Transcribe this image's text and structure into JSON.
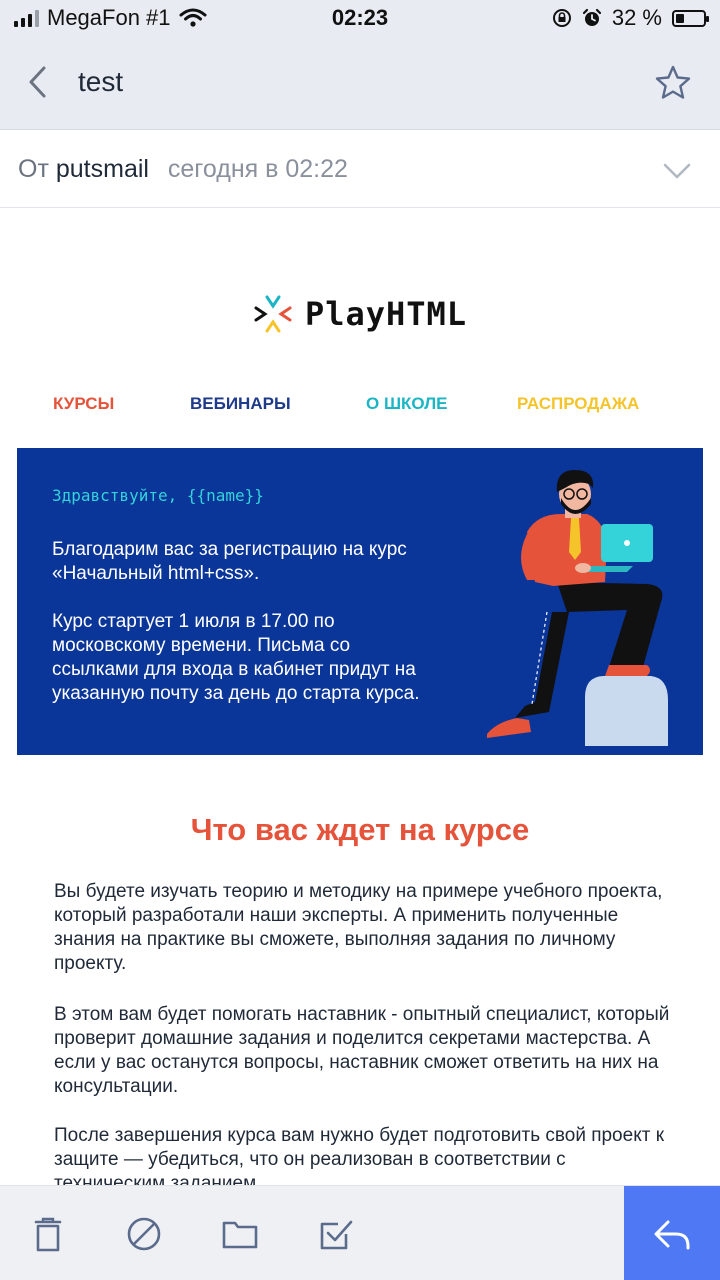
{
  "status_bar": {
    "carrier": "MegaFon #1",
    "time": "02:23",
    "battery_percent": "32 %",
    "battery_level": 0.32
  },
  "nav": {
    "title": "test"
  },
  "sender": {
    "prefix": "От",
    "name": "putsmail",
    "time": "сегодня в 02:22"
  },
  "email": {
    "logo_text": "PlayHTML",
    "menu": [
      "КУРСЫ",
      "ВЕБИНАРЫ",
      "О ШКОЛЕ",
      "РАСПРОДАЖА"
    ],
    "greeting": "Здравствуйте, {{name}}",
    "banner_text_1": "Благодарим вас за регистрацию на курс «Начальный html+css».",
    "banner_text_2": "Курс стартует 1 июля в 17.00 по московскому времени. Письма со ссылками для входа в кабинет придут на указанную почту за день до старта курса.",
    "section_title": "Что вас ждет на курсе",
    "paragraph_1": "Вы будете изучать теорию и методику на примере учебного проекта, который разработали наши эксперты. А применить полученные знания на практике вы сможете, выполняя задания по личному проекту.",
    "paragraph_2": "В этом вам будет помогать наставник - опытный специалист, который проверит домашние задания и поделится секретами мастерства. А если у вас останутся вопросы, наставник сможет ответить на них на консультации.",
    "paragraph_3": "После завершения курса вам нужно будет подготовить свой проект к защите — убедиться, что он реализован в соответствии с техническим заданием"
  },
  "colors": {
    "accent_red": "#e4533a",
    "navy": "#1e3a8a",
    "teal": "#1bb5c4",
    "yellow": "#f5c42b",
    "banner_blue": "#0a3599",
    "reply_blue": "#4f78f4"
  },
  "icons": {
    "back": "chevron-left-icon",
    "favorite": "star-icon",
    "expand": "chevron-down-icon",
    "trash": "trash-icon",
    "spam": "block-icon",
    "move": "folder-icon",
    "mark": "checkbox-icon",
    "reply": "reply-icon"
  }
}
